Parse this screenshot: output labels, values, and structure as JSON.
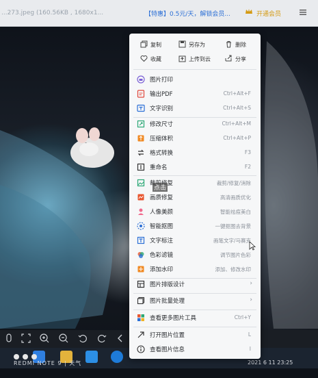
{
  "topbar": {
    "filename": "...273.jpeg (160.56KB , 1680x1...",
    "promo": "【特惠】0.5元/天，解锁会员...",
    "open_vip": "开通会员"
  },
  "photo": {
    "watermark": "REDMI NOTE 9 | 天气",
    "timestamp": "2021 6 11  23:25"
  },
  "menu": {
    "quick_actions": [
      {
        "label": "复制",
        "icon": "copy-icon"
      },
      {
        "label": "另存为",
        "icon": "save-as-icon"
      },
      {
        "label": "删除",
        "icon": "trash-icon"
      },
      {
        "label": "收藏",
        "icon": "heart-icon"
      },
      {
        "label": "上传到云",
        "icon": "cloud-upload-icon"
      },
      {
        "label": "分享",
        "icon": "share-icon"
      }
    ],
    "items": [
      {
        "label": "图片打印",
        "shortcut": "",
        "icon": "print-icon"
      },
      {
        "label": "输出PDF",
        "shortcut": "Ctrl+Alt+F",
        "icon": "pdf-icon"
      },
      {
        "label": "文字识别",
        "shortcut": "Ctrl+Alt+S",
        "icon": "ocr-icon"
      },
      {
        "label": "修改尺寸",
        "shortcut": "Ctrl+Alt+M",
        "icon": "resize-icon"
      },
      {
        "label": "压缩体积",
        "shortcut": "Ctrl+Alt+P",
        "icon": "compress-icon"
      },
      {
        "label": "格式转换",
        "shortcut": "F3",
        "icon": "convert-icon"
      },
      {
        "label": "重命名",
        "shortcut": "F2",
        "icon": "rename-icon"
      },
      {
        "label": "裁剪修复",
        "shortcut": "裁剪/修复/消除",
        "icon": "crop-icon"
      },
      {
        "label": "画质修复",
        "shortcut": "高清画质优化",
        "icon": "enhance-icon"
      },
      {
        "label": "人像美颜",
        "shortcut": "智能祛痘美白",
        "icon": "beauty-icon"
      },
      {
        "label": "智能抠图",
        "shortcut": "一键抠图去背景",
        "icon": "cutout-icon"
      },
      {
        "label": "文字标注",
        "shortcut": "画笔文字/马赛克",
        "icon": "annotate-icon"
      },
      {
        "label": "色彩滤镜",
        "shortcut": "调节图片色彩",
        "icon": "filter-icon"
      },
      {
        "label": "添加水印",
        "shortcut": "添加、修改水印",
        "icon": "watermark-icon"
      },
      {
        "label": "图片排版设计",
        "shortcut": "",
        "icon": "layout-icon"
      },
      {
        "label": "图片批量处理",
        "shortcut": "",
        "icon": "batch-icon"
      },
      {
        "label": "查看更多图片工具",
        "shortcut": "Ctrl+Y",
        "icon": "more-tools-icon"
      },
      {
        "label": "打开图片位置",
        "shortcut": "L",
        "icon": "folder-location-icon"
      },
      {
        "label": "查看图片信息",
        "shortcut": "I",
        "icon": "info-icon"
      }
    ],
    "hover_tooltip": "点击"
  },
  "colors": {
    "accent": "#2b6fd6",
    "vip": "#d49a12",
    "menu_bg": "#f6f7f8"
  }
}
